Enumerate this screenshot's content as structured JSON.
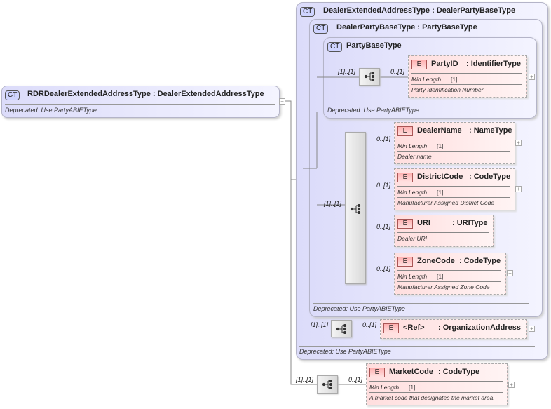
{
  "root": {
    "badge": "CT",
    "title": "RDRDealerExtendedAddressType : DealerExtendedAddressType",
    "doc": "Deprecated: Use PartyABIEType"
  },
  "outer": {
    "badge": "CT",
    "title": "DealerExtendedAddressType : DealerPartyBaseType",
    "doc": "Deprecated: Use PartyABIEType"
  },
  "middle": {
    "badge": "CT",
    "title": "DealerPartyBaseType : PartyBaseType",
    "doc": "Deprecated: Use PartyABIEType"
  },
  "inner": {
    "badge": "CT",
    "title": "PartyBaseType",
    "doc": "Deprecated: Use PartyABIEType"
  },
  "min_length_label": "Min Length",
  "min_length_value": "[1]",
  "element_badge": "E",
  "seq_card": "[1]..[1]",
  "elem_card": "0..[1]",
  "elements": [
    {
      "name": "PartyID",
      "type": ": IdentifierType",
      "doc": "Party Identification Number"
    },
    {
      "name": "DealerName",
      "type": ": NameType",
      "doc": "Dealer name"
    },
    {
      "name": "DistrictCode",
      "type": ": CodeType",
      "doc": "Manufacturer Assigned District Code"
    },
    {
      "name": "URI",
      "type": ": URIType",
      "doc": "Dealer URI"
    },
    {
      "name": "ZoneCode",
      "type": ": CodeType",
      "doc": "Manufacturer Assigned Zone Code"
    },
    {
      "name": "<Ref>",
      "type": ": OrganizationAddress"
    },
    {
      "name": "MarketCode",
      "type": ": CodeType",
      "doc": "A market code that designates the market area."
    }
  ],
  "expand_symbol": "+",
  "collapse_symbol": "−"
}
